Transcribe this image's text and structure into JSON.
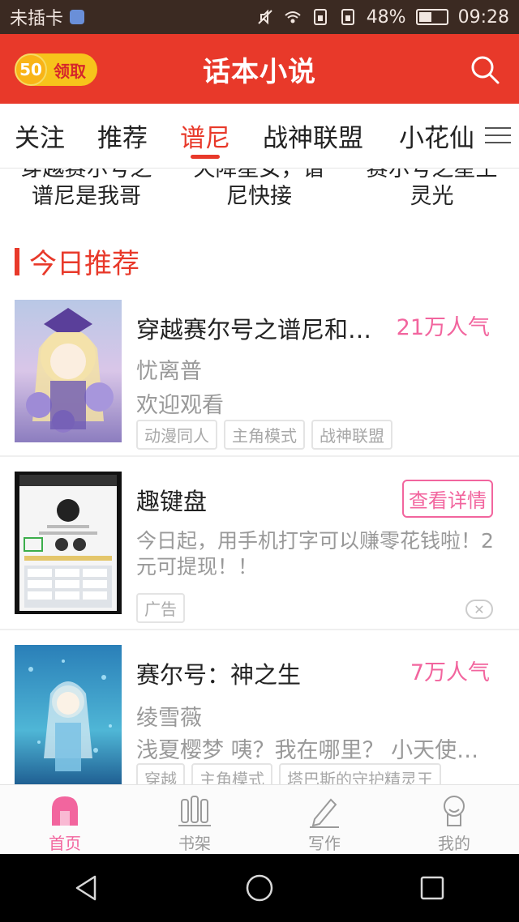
{
  "status_bar": {
    "carrier": "未插卡",
    "battery": "48%",
    "battery_level": 0.48,
    "time": "09:28"
  },
  "header": {
    "coin_count": "50",
    "coin_action": "领取",
    "title": "话本小说"
  },
  "tabs": [
    {
      "label": "关注",
      "active": false
    },
    {
      "label": "推荐",
      "active": false
    },
    {
      "label": "谱尼",
      "active": true
    },
    {
      "label": "战神联盟",
      "active": false
    },
    {
      "label": "小花仙",
      "active": false
    }
  ],
  "partial_titles": [
    {
      "line1": "穿越赛尔号之",
      "line2": "谱尼是我哥"
    },
    {
      "line1": "天降星女，谱",
      "line2": "尼快接"
    },
    {
      "line1": "赛尔号之星王",
      "line2": "灵光"
    }
  ],
  "section": {
    "title": "今日推荐"
  },
  "books": [
    {
      "title": "穿越赛尔号之谱尼和…",
      "popularity": "21万人气",
      "author": "忧离普",
      "description": "欢迎观看",
      "tags": [
        "动漫同人",
        "主角模式",
        "战神联盟"
      ]
    },
    {
      "title": "赛尔号：神之生",
      "popularity": "7万人气",
      "author": "绫雪薇",
      "description": "浅夏樱梦 咦？我在哪里？ 小天使…",
      "tags": [
        "穿越",
        "主角模式",
        "塔巴斯的守护精灵王"
      ]
    }
  ],
  "ad": {
    "title": "趣键盘",
    "detail_button": "查看详情",
    "description": "今日起，用手机打字可以赚零花钱啦！2元可提现！！",
    "tag": "广告"
  },
  "bottom_nav": [
    {
      "label": "首页",
      "icon": "home-icon",
      "active": true
    },
    {
      "label": "书架",
      "icon": "bookshelf-icon",
      "active": false
    },
    {
      "label": "写作",
      "icon": "pen-icon",
      "active": false
    },
    {
      "label": "我的",
      "icon": "profile-icon",
      "active": false
    }
  ],
  "colors": {
    "header_red": "#e8392a",
    "accent_pink": "#f2659e",
    "coin_yellow": "#f7c31b"
  }
}
